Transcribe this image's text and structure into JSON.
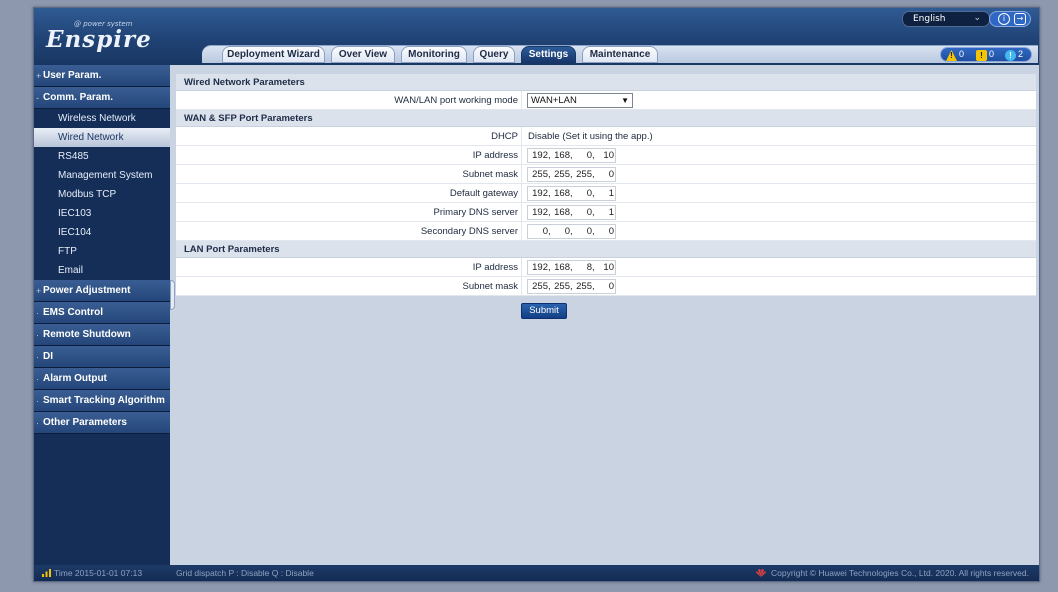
{
  "header": {
    "logo_tagline": "@ power system",
    "logo_text": "Enspire",
    "language": "English"
  },
  "tabs": [
    {
      "label": "Deployment Wizard"
    },
    {
      "label": "Over View"
    },
    {
      "label": "Monitoring"
    },
    {
      "label": "Query"
    },
    {
      "label": "Settings",
      "active": true
    },
    {
      "label": "Maintenance"
    }
  ],
  "alarms": {
    "major": "0",
    "minor": "0",
    "warning": "2"
  },
  "sidebar": {
    "groups": [
      {
        "label": "User Param.",
        "sign": "+"
      },
      {
        "label": "Comm. Param.",
        "sign": "-"
      },
      {
        "label": "Power Adjustment",
        "sign": "+"
      },
      {
        "label": "EMS Control",
        "sign": "·"
      },
      {
        "label": "Remote Shutdown",
        "sign": "·"
      },
      {
        "label": "DI",
        "sign": "·"
      },
      {
        "label": "Alarm Output",
        "sign": "·"
      },
      {
        "label": "Smart Tracking Algorithm",
        "sign": "·"
      },
      {
        "label": "Other Parameters",
        "sign": "·"
      }
    ],
    "comm_items": [
      "Wireless Network",
      "Wired Network",
      "RS485",
      "Management System",
      "Modbus TCP",
      "IEC103",
      "IEC104",
      "FTP",
      "Email"
    ]
  },
  "main": {
    "wired_section": "Wired Network Parameters",
    "mode_label": "WAN/LAN port working mode",
    "mode_value": "WAN+LAN",
    "wan_section": "WAN & SFP Port Parameters",
    "dhcp_label": "DHCP",
    "dhcp_value": "Disable (Set it using the app.)",
    "wan_rows": [
      {
        "label": "IP address",
        "ip": [
          "192",
          "168",
          "0",
          "10"
        ]
      },
      {
        "label": "Subnet mask",
        "ip": [
          "255",
          "255",
          "255",
          "0"
        ]
      },
      {
        "label": "Default gateway",
        "ip": [
          "192",
          "168",
          "0",
          "1"
        ]
      },
      {
        "label": "Primary DNS server",
        "ip": [
          "192",
          "168",
          "0",
          "1"
        ]
      },
      {
        "label": "Secondary DNS server",
        "ip": [
          "0",
          "0",
          "0",
          "0"
        ]
      }
    ],
    "lan_section": "LAN Port Parameters",
    "lan_rows": [
      {
        "label": "IP address",
        "ip": [
          "192",
          "168",
          "8",
          "10"
        ]
      },
      {
        "label": "Subnet mask",
        "ip": [
          "255",
          "255",
          "255",
          "0"
        ]
      }
    ],
    "submit": "Submit"
  },
  "footer": {
    "time": "Time  2015-01-01 07:13",
    "grid_status": "Grid dispatch  P : Disable  Q : Disable",
    "copyright": "Copyright © Huawei Technologies Co., Ltd. 2020. All rights reserved."
  },
  "colors": {
    "header": "#204375",
    "sidebar": "#142e58",
    "accent": "#1f4f9f",
    "content_bg": "#c9d3e2"
  }
}
